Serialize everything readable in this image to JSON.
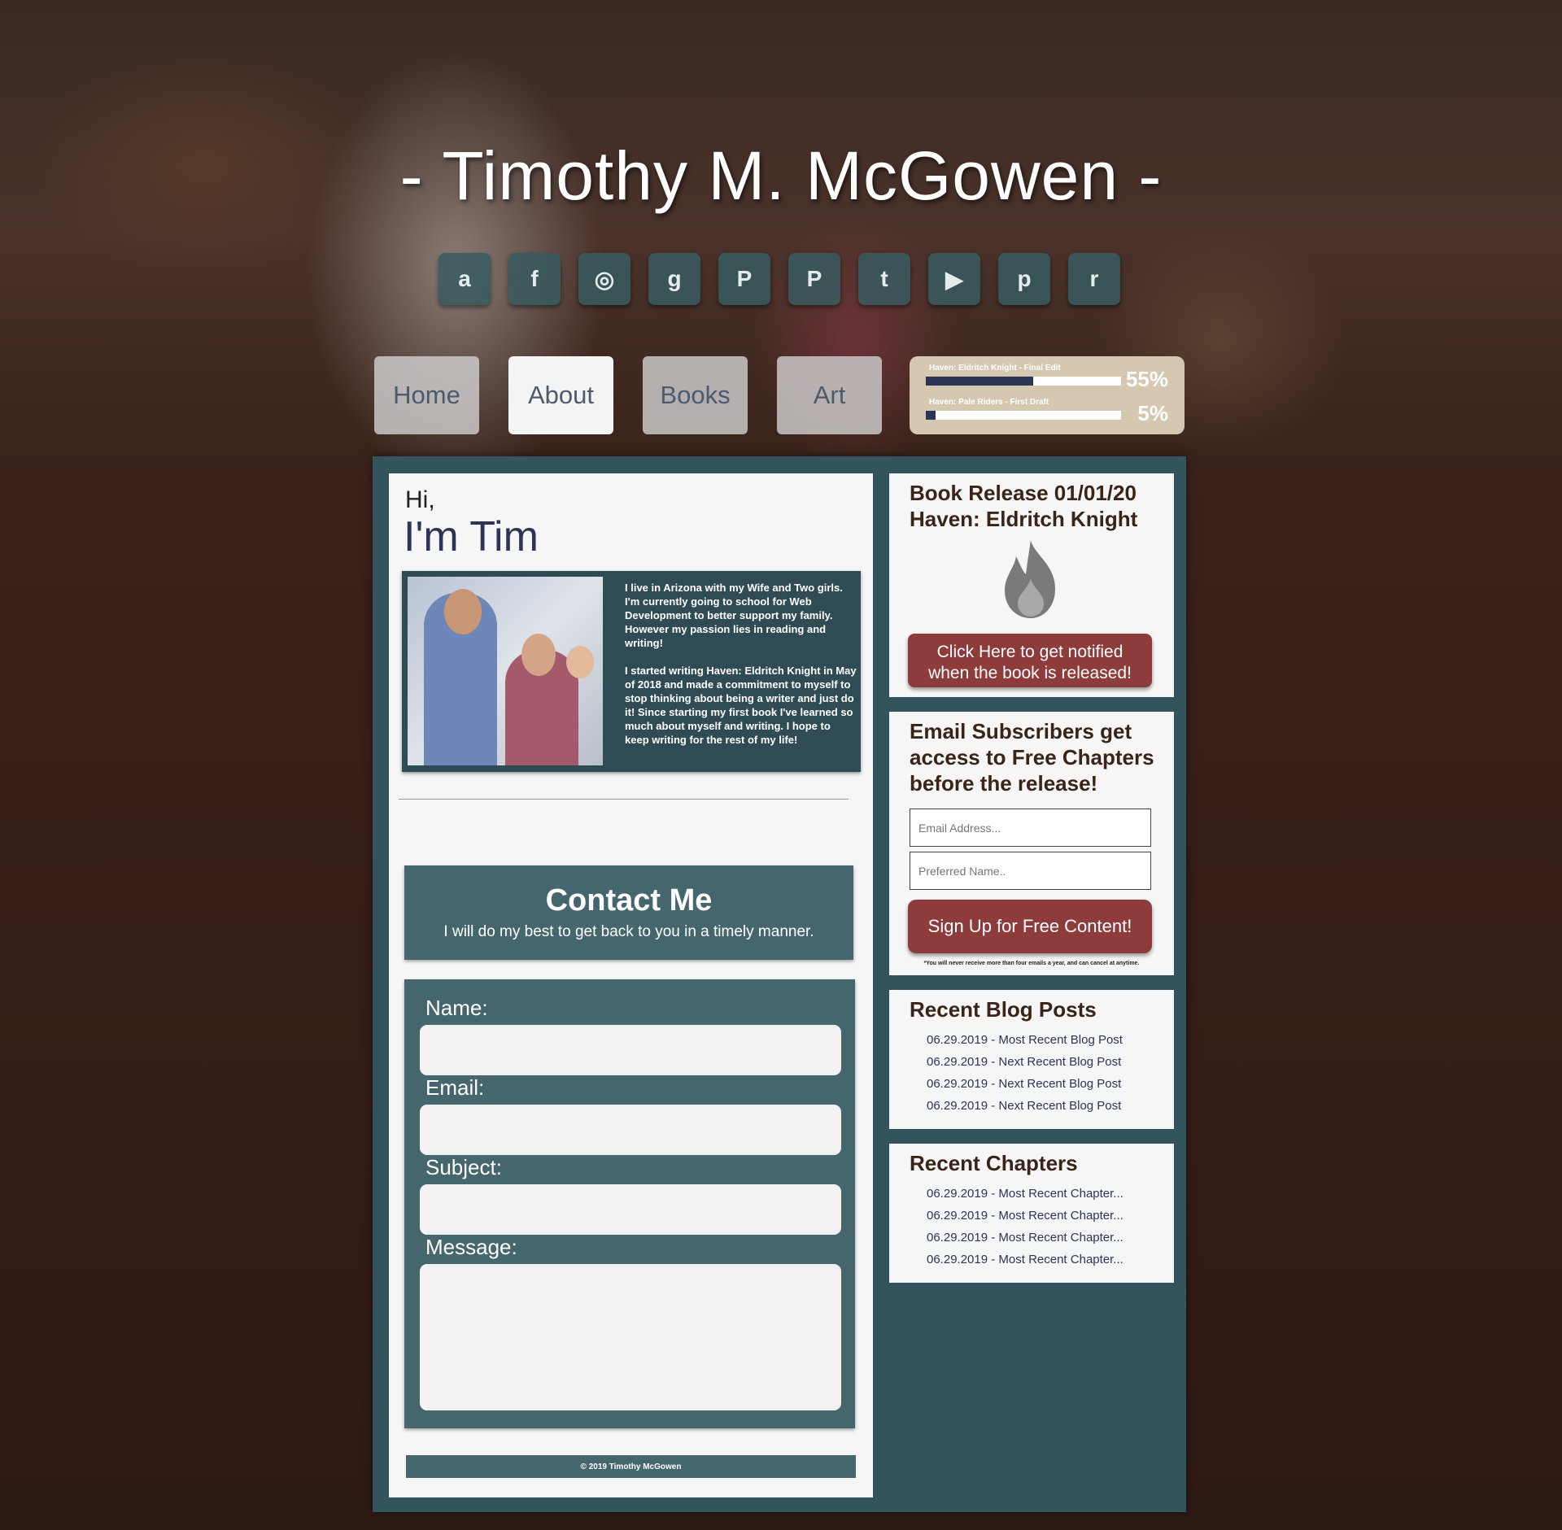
{
  "site": {
    "title": "- Timothy M. McGowen -"
  },
  "social": [
    {
      "icon": "amazon-icon",
      "glyph": "a"
    },
    {
      "icon": "facebook-icon",
      "glyph": "f"
    },
    {
      "icon": "instagram-icon",
      "glyph": "◎"
    },
    {
      "icon": "goodreads-icon",
      "glyph": "g"
    },
    {
      "icon": "patreon-icon",
      "glyph": "P"
    },
    {
      "icon": "paypal-icon",
      "glyph": "P"
    },
    {
      "icon": "twitter-icon",
      "glyph": "t"
    },
    {
      "icon": "youtube-icon",
      "glyph": "▶"
    },
    {
      "icon": "pinterest-icon",
      "glyph": "p"
    },
    {
      "icon": "reddit-icon",
      "glyph": "r"
    }
  ],
  "nav": {
    "tabs": [
      {
        "label": "Home",
        "active": false
      },
      {
        "label": "About",
        "active": true
      },
      {
        "label": "Books",
        "active": false
      },
      {
        "label": "Art",
        "active": false
      }
    ]
  },
  "progress": [
    {
      "label": "Haven: Eldritch Knight - Final Edit",
      "percent": 55,
      "display": "55%"
    },
    {
      "label": "Haven: Pale Riders - First Draft",
      "percent": 5,
      "display": "5%"
    }
  ],
  "about": {
    "greeting": "Hi,",
    "name": "I'm Tim",
    "paragraph1": "I live in Arizona with my Wife and Two girls. I'm currently going to school for Web Development to better support my family. However my passion lies in reading and writing!",
    "paragraph2": "I started writing Haven: Eldritch Knight in May of 2018 and made a commitment to myself to stop thinking about being a writer and just do it! Since starting my first book I've learned so much about myself and writing. I hope to keep writing for the rest of my life!"
  },
  "contact": {
    "title": "Contact Me",
    "subtitle": "I will do my best to get back to you in a timely manner.",
    "name_label": "Name:",
    "email_label": "Email:",
    "subject_label": "Subject:",
    "message_label": "Message:"
  },
  "footer": {
    "text": "© 2019 Timothy McGowen"
  },
  "release": {
    "title_line1": "Book Release 01/01/20",
    "title_line2": "Haven: Eldritch Knight",
    "button_line1": "Click Here to get notified",
    "button_line2": "when the book is released!"
  },
  "subscribe": {
    "title_line1": "Email Subscribers get",
    "title_line2": "access to Free Chapters",
    "title_line3": "before the release!",
    "email_placeholder": "Email Address...",
    "name_placeholder": "Preferred Name..",
    "button": "Sign Up for Free Content!",
    "disclaimer": "*You will never receive more than four emails a year, and can cancel at anytime."
  },
  "blog": {
    "title": "Recent Blog Posts",
    "items": [
      "06.29.2019 - Most Recent Blog Post",
      "06.29.2019 - Next Recent Blog Post",
      "06.29.2019 - Next Recent Blog Post",
      "06.29.2019 - Next Recent Blog Post"
    ]
  },
  "chapters": {
    "title": "Recent Chapters",
    "items": [
      "06.29.2019 - Most Recent Chapter...",
      "06.29.2019 - Most Recent Chapter...",
      "06.29.2019 - Most Recent Chapter...",
      "06.29.2019 - Most Recent Chapter..."
    ]
  },
  "colors": {
    "panel": "#33545c",
    "button_red": "#8e3b3b",
    "navy": "#2d3456",
    "heading_brown": "#3a2418"
  }
}
